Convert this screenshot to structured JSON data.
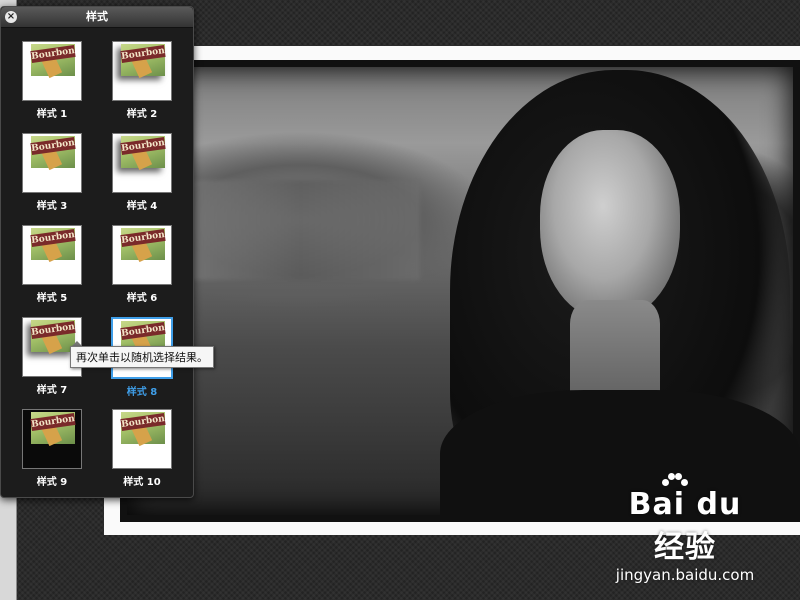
{
  "panel": {
    "title": "样式",
    "close_icon": "close-icon",
    "styles": [
      {
        "label": "样式 1",
        "thumb_text": "Bourbon"
      },
      {
        "label": "样式 2",
        "thumb_text": "Bourbon"
      },
      {
        "label": "样式 3",
        "thumb_text": "Bourbon"
      },
      {
        "label": "样式 4",
        "thumb_text": "Bourbon"
      },
      {
        "label": "样式 5",
        "thumb_text": "Bourbon"
      },
      {
        "label": "样式 6",
        "thumb_text": "Bourbon"
      },
      {
        "label": "样式 7",
        "thumb_text": "Bourbon"
      },
      {
        "label": "样式 8",
        "thumb_text": "Bourbon",
        "selected": true
      },
      {
        "label": "样式 9",
        "thumb_text": "Bourbon"
      },
      {
        "label": "样式 10",
        "thumb_text": "Bourbon"
      }
    ]
  },
  "tooltip": {
    "text": "再次单击以随机选择结果。"
  },
  "watermark": {
    "logo_text": "Bai du 经验",
    "url": "jingyan.baidu.com"
  },
  "colors": {
    "panel_bg": "#1c1c1c",
    "accent_blue": "#3f9ee8",
    "label": "#ffffff"
  }
}
